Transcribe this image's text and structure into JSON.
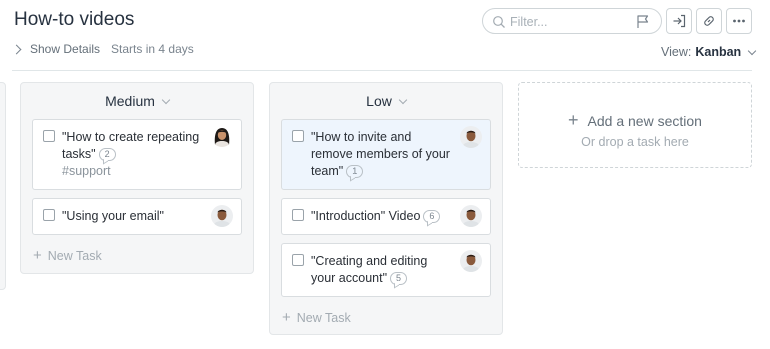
{
  "header": {
    "title": "How-to videos",
    "show_details": "Show Details",
    "starts": "Starts in 4 days",
    "filter_placeholder": "Filter...",
    "view_label": "View:",
    "view_value": "Kanban"
  },
  "icons": {
    "search": "search-icon",
    "flag": "flag-icon",
    "export": "export-icon",
    "link": "link-icon",
    "more": "more-icon"
  },
  "columns": [
    {
      "title": "Medium",
      "tasks": [
        {
          "title": "\"How to create repeating tasks\"",
          "comments": "2",
          "tag": "#support"
        },
        {
          "title": "\"Using your email\""
        }
      ],
      "new_task": "New Task"
    },
    {
      "title": "Low",
      "tasks": [
        {
          "title": "\"How to invite and remove members of your team\"",
          "comments": "1"
        },
        {
          "title": "\"Introduction\" Video",
          "comments": "6"
        },
        {
          "title": "\"Creating and editing your account\"",
          "comments": "5"
        }
      ],
      "new_task": "New Task"
    }
  ],
  "add_section": {
    "title": "Add a new section",
    "subtitle": "Or drop a task here"
  }
}
